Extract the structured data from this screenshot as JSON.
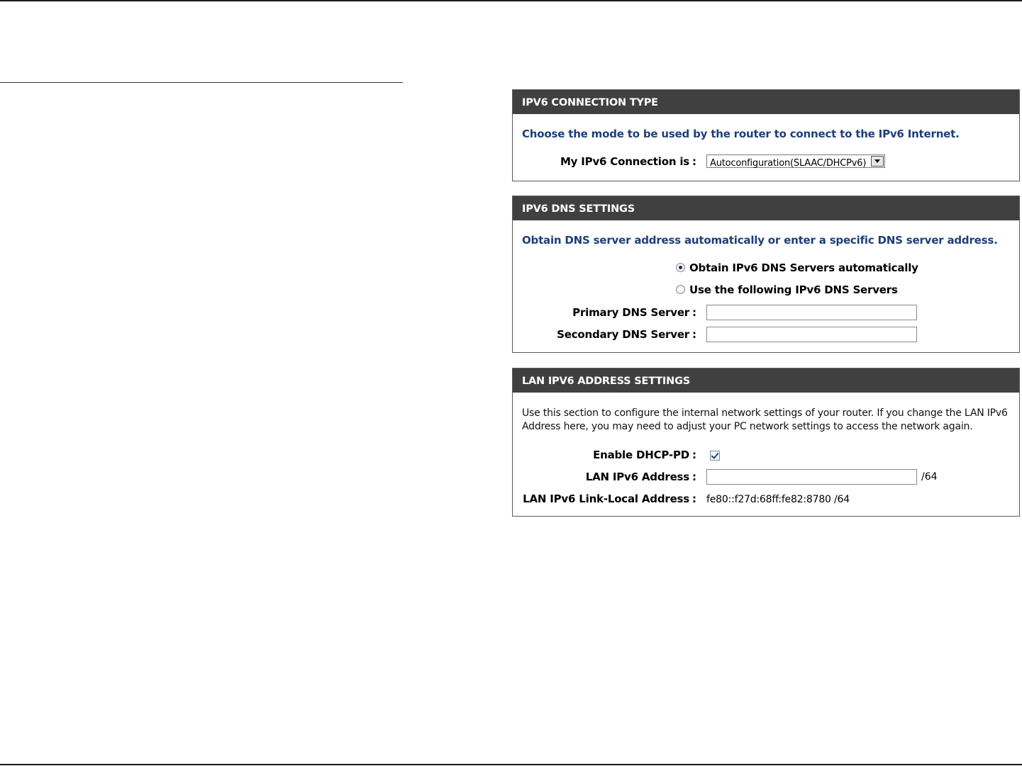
{
  "connection_type": {
    "header": "IPV6 CONNECTION TYPE",
    "intro": "Choose the mode to be used by the router to connect to the IPv6 Internet.",
    "label": "My IPv6 Connection is",
    "colon": ":",
    "selected": "Autoconfiguration(SLAAC/DHCPv6)"
  },
  "dns_settings": {
    "header": "IPV6 DNS SETTINGS",
    "intro": "Obtain DNS server address automatically or enter a specific DNS server address.",
    "radio_auto_label": "Obtain IPv6 DNS Servers automatically",
    "radio_auto_checked": true,
    "radio_manual_label": "Use the following IPv6 DNS Servers",
    "radio_manual_checked": false,
    "primary_label": "Primary DNS Server",
    "primary_value": "",
    "secondary_label": "Secondary DNS Server",
    "secondary_value": "",
    "colon": ":"
  },
  "lan_settings": {
    "header": "LAN IPV6 ADDRESS SETTINGS",
    "description": "Use this section to configure the internal network settings of your router. If you change the LAN IPv6 Address here, you may need to adjust your PC network settings to access the network again.",
    "dhcp_pd_label": "Enable DHCP-PD",
    "dhcp_pd_checked": true,
    "lan_address_label": "LAN IPv6 Address",
    "lan_address_value": "",
    "lan_address_suffix": "/64",
    "link_local_label": "LAN IPv6 Link-Local Address",
    "link_local_value": "fe80::f27d:68ff:fe82:8780 /64",
    "colon": ":"
  }
}
